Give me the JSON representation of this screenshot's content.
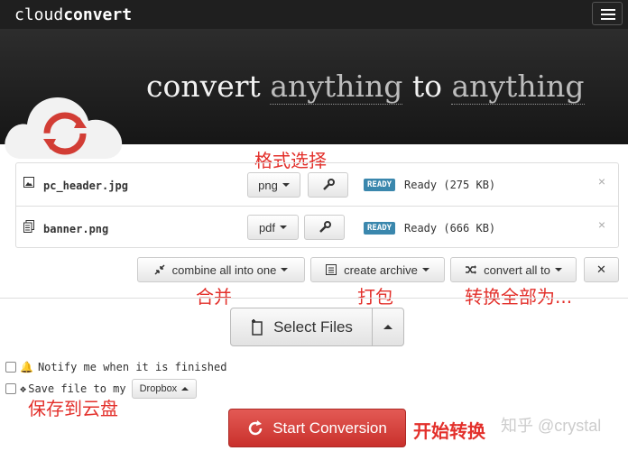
{
  "brand": {
    "prefix": "cloud",
    "bold": "convert"
  },
  "tagline": {
    "w1": "convert",
    "w2": "anything",
    "w3": "to",
    "w4": "anything"
  },
  "files": [
    {
      "name": "pc_header.jpg",
      "format": "png",
      "badge": "READY",
      "status": "Ready (275 KB)",
      "remove": "×"
    },
    {
      "name": "banner.png",
      "format": "pdf",
      "badge": "READY",
      "status": "Ready (666 KB)",
      "remove": "×"
    }
  ],
  "actions": {
    "combine": "combine all into one",
    "archive": "create archive",
    "convert_all": "convert all to",
    "close": "✕"
  },
  "select_files": "Select Files",
  "options": {
    "notify": "Notify me when it is finished",
    "save": "Save file to my",
    "dropbox": "Dropbox"
  },
  "start": "Start Conversion",
  "annotations": {
    "format": "格式选择",
    "combine": "合并",
    "archive": "打包",
    "convert_all": "转换全部为...",
    "save": "保存到云盘",
    "start": "开始转换"
  },
  "watermark": "知乎 @crystal",
  "colors": {
    "accent_red": "#e3302b",
    "ready_badge": "#3a87ad",
    "start_button": "#d9534f"
  }
}
